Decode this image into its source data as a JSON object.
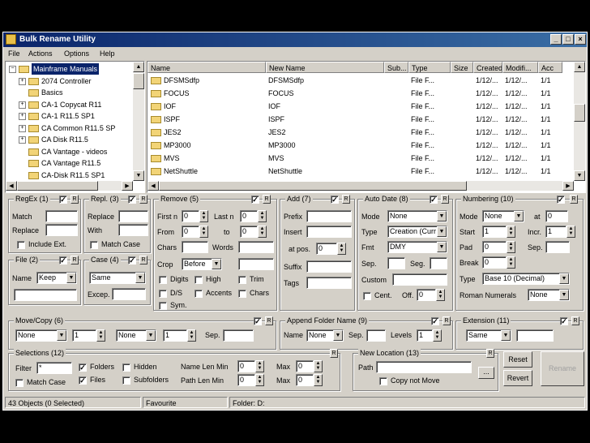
{
  "window": {
    "title": "Bulk Rename Utility"
  },
  "menu": [
    "File",
    "Actions",
    "Options",
    "Help"
  ],
  "tree": {
    "items": [
      {
        "label": "Mainframe Manuals",
        "selected": true,
        "indent": 0,
        "expander": "-"
      },
      {
        "label": "2074 Controller",
        "indent": 1,
        "expander": "+"
      },
      {
        "label": "Basics",
        "indent": 1,
        "expander": ""
      },
      {
        "label": "CA-1 Copycat R11",
        "indent": 1,
        "expander": "+"
      },
      {
        "label": "CA-1 R11.5 SP1",
        "indent": 1,
        "expander": "+"
      },
      {
        "label": "CA Common R11.5 SP",
        "indent": 1,
        "expander": "+"
      },
      {
        "label": "CA Disk R11.5",
        "indent": 1,
        "expander": "+"
      },
      {
        "label": "CA Vantage - videos",
        "indent": 1,
        "expander": ""
      },
      {
        "label": "CA Vantage R11.5",
        "indent": 1,
        "expander": ""
      },
      {
        "label": "CA-Disk R11.5 SP1",
        "indent": 1,
        "expander": ""
      }
    ]
  },
  "filelist": {
    "columns": [
      "Name",
      "New Name",
      "Sub...",
      "Type",
      "Size",
      "Created",
      "Modifi...",
      "Acc"
    ],
    "rows": [
      [
        "DFSMSdfp",
        "DFSMSdfp",
        "",
        "File F...",
        "",
        "1/12/...",
        "1/12/...",
        "1/1"
      ],
      [
        "FOCUS",
        "FOCUS",
        "",
        "File F...",
        "",
        "1/12/...",
        "1/12/...",
        "1/1"
      ],
      [
        "IOF",
        "IOF",
        "",
        "File F...",
        "",
        "1/12/...",
        "1/12/...",
        "1/1"
      ],
      [
        "ISPF",
        "ISPF",
        "",
        "File F...",
        "",
        "1/12/...",
        "1/12/...",
        "1/1"
      ],
      [
        "JES2",
        "JES2",
        "",
        "File F...",
        "",
        "1/12/...",
        "1/12/...",
        "1/1"
      ],
      [
        "MP3000",
        "MP3000",
        "",
        "File F...",
        "",
        "1/12/...",
        "1/12/...",
        "1/1"
      ],
      [
        "MVS",
        "MVS",
        "",
        "File F...",
        "",
        "1/12/...",
        "1/12/...",
        "1/1"
      ],
      [
        "NetShuttle",
        "NetShuttle",
        "",
        "File F...",
        "",
        "1/12/...",
        "1/12/...",
        "1/1"
      ]
    ]
  },
  "regex": {
    "title": "RegEx (1)",
    "match": "Match",
    "replace": "Replace",
    "include_ext": "Include Ext."
  },
  "repl": {
    "title": "Repl. (3)",
    "replace": "Replace",
    "with": "With",
    "match_case": "Match Case"
  },
  "remove": {
    "title": "Remove (5)",
    "first_n": "First n",
    "first_n_val": "0",
    "last_n": "Last n",
    "last_n_val": "0",
    "from": "From",
    "from_val": "0",
    "to": "to",
    "to_val": "0",
    "chars": "Chars",
    "words": "Words",
    "crop": "Crop",
    "crop_val": "Before",
    "digits": "Digits",
    "high": "High",
    "trim": "Trim",
    "ds": "D/S",
    "accents": "Accents",
    "chars_chk": "Chars",
    "sym": "Sym."
  },
  "add": {
    "title": "Add (7)",
    "prefix": "Prefix",
    "insert": "Insert",
    "at_pos": "at pos.",
    "at_pos_val": "0",
    "suffix": "Suffix",
    "tags": "Tags"
  },
  "autodate": {
    "title": "Auto Date (8)",
    "mode": "Mode",
    "mode_val": "None",
    "type": "Type",
    "type_val": "Creation (Curr",
    "fmt": "Fmt",
    "fmt_val": "DMY",
    "sep": "Sep.",
    "seg": "Seg.",
    "custom": "Custom",
    "cent": "Cent.",
    "off": "Off.",
    "off_val": "0"
  },
  "numbering": {
    "title": "Numbering (10)",
    "mode": "Mode",
    "mode_val": "None",
    "at": "at",
    "at_val": "0",
    "start": "Start",
    "start_val": "1",
    "incr": "Incr.",
    "incr_val": "1",
    "pad": "Pad",
    "pad_val": "0",
    "sep": "Sep.",
    "break": "Break",
    "break_val": "0",
    "type": "Type",
    "type_val": "Base 10 (Decimal)",
    "roman": "Roman Numerals",
    "roman_val": "None"
  },
  "file": {
    "title": "File (2)",
    "name": "Name",
    "name_val": "Keep"
  },
  "case": {
    "title": "Case (4)",
    "case_val": "Same",
    "excep": "Excep."
  },
  "movecopy": {
    "title": "Move/Copy (6)",
    "sel1": "None",
    "num1": "1",
    "sel2": "None",
    "num2": "1",
    "sep": "Sep."
  },
  "appendfolder": {
    "title": "Append Folder Name (9)",
    "name": "Name",
    "name_val": "None",
    "sep": "Sep.",
    "levels": "Levels",
    "levels_val": "1"
  },
  "extension": {
    "title": "Extension (11)",
    "val": "Same"
  },
  "selections": {
    "title": "Selections (12)",
    "filter": "Filter",
    "filter_val": "*",
    "folders": "Folders",
    "hidden": "Hidden",
    "files": "Files",
    "subfolders": "Subfolders",
    "match_case": "Match Case",
    "name_len_min": "Name Len Min",
    "name_len_min_val": "0",
    "path_len_min": "Path Len Min",
    "path_len_min_val": "0",
    "max": "Max",
    "max1_val": "0",
    "max2_val": "0"
  },
  "newlocation": {
    "title": "New Location (13)",
    "path": "Path",
    "copy_not_move": "Copy not Move",
    "browse": "..."
  },
  "buttons": {
    "reset": "Reset",
    "revert": "Revert",
    "rename": "Rename"
  },
  "status": {
    "objects": "43 Objects (0 Selected)",
    "favourite": "Favourite",
    "folder": "Folder: D:"
  }
}
